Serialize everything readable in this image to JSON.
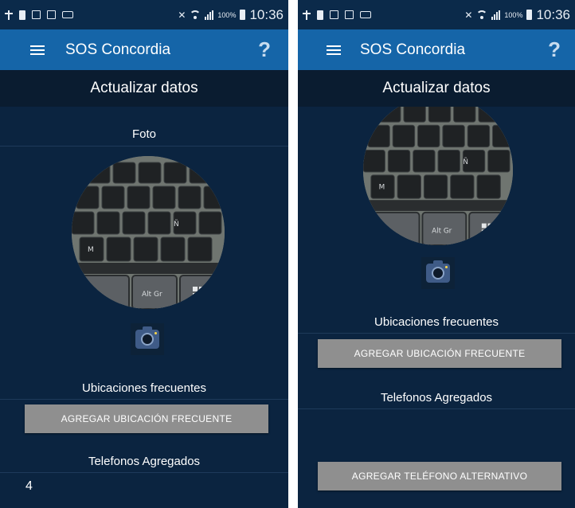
{
  "status_bar": {
    "battery_percent": "100%",
    "time": "10:36"
  },
  "app_bar": {
    "title": "SOS Concordia",
    "help_label": "?"
  },
  "left_screen": {
    "section_title": "Actualizar datos",
    "photo_label": "Foto",
    "locations_label": "Ubicaciones frecuentes",
    "add_location_button": "AGREGAR UBICACIÓN FRECUENTE",
    "phones_label": "Telefonos Agregados",
    "phone_input_value": "4"
  },
  "right_screen": {
    "section_title": "Actualizar datos",
    "locations_label": "Ubicaciones frecuentes",
    "add_location_button": "AGREGAR UBICACIÓN FRECUENTE",
    "phones_label": "Telefonos Agregados",
    "add_phone_button": "AGREGAR TELÉFONO ALTERNATIVO"
  },
  "icons": {
    "menu": "hamburger-menu-icon",
    "help": "question-mark-icon",
    "camera": "camera-icon",
    "status": [
      "usb-icon",
      "storage-icon",
      "file-icon",
      "image-icon",
      "voicemail-icon",
      "mute-icon",
      "wifi-icon",
      "signal-icon",
      "battery-icon"
    ]
  },
  "colors": {
    "background": "#0b2440",
    "app_bar": "#1565a8",
    "section_header": "#0a1c30",
    "button": "#8f8f8f",
    "camera": "#3f5b87"
  }
}
